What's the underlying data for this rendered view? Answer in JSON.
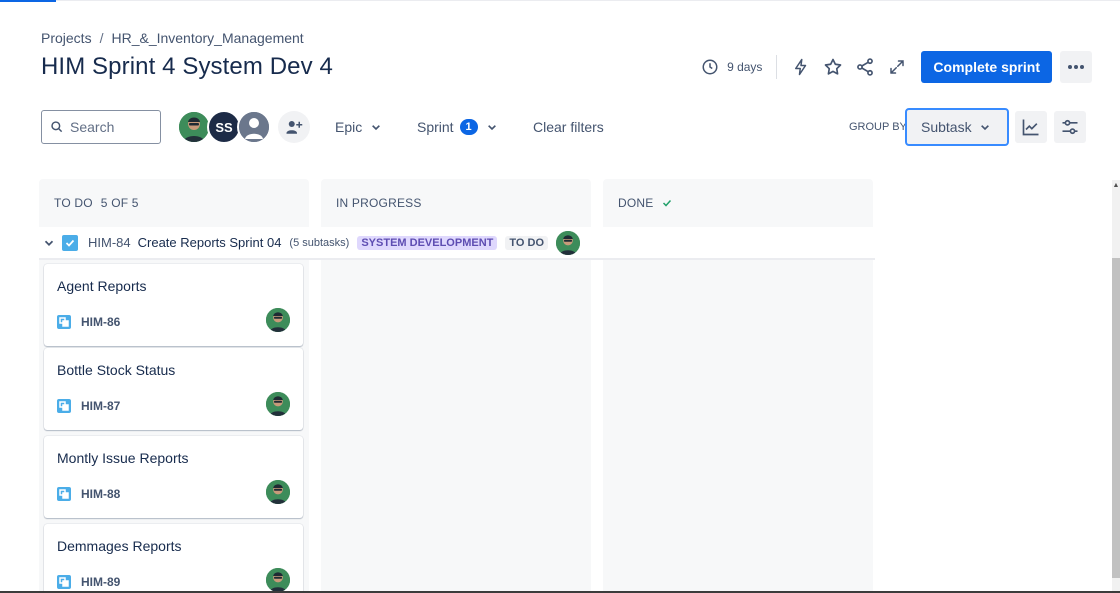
{
  "breadcrumb": {
    "projects": "Projects",
    "separator": "/",
    "project": "HR_&_Inventory_Management"
  },
  "title": "HIM Sprint 4 System Dev 4",
  "header": {
    "days_remaining": "9 days",
    "complete_sprint": "Complete sprint",
    "icons": [
      "clock-icon",
      "lightning-icon",
      "star-icon",
      "share-icon",
      "expand-icon",
      "more-icon"
    ]
  },
  "toolbar": {
    "search_placeholder": "Search",
    "avatars": [
      {
        "type": "photo"
      },
      {
        "type": "initials",
        "initials": "SS"
      },
      {
        "type": "generic"
      }
    ],
    "filters": {
      "epic": "Epic",
      "sprint": "Sprint",
      "sprint_count": "1",
      "clear": "Clear filters"
    },
    "group_by_label": "GROUP BY",
    "group_by_value": "Subtask"
  },
  "columns": [
    {
      "name": "TO DO",
      "count_text": "5 OF 5"
    },
    {
      "name": "IN PROGRESS"
    },
    {
      "name": "DONE"
    }
  ],
  "swimlane": {
    "key": "HIM-84",
    "summary": "Create Reports Sprint 04",
    "subtask_count": "(5 subtasks)",
    "epic": "SYSTEM DEVELOPMENT",
    "status": "TO DO"
  },
  "cards": [
    {
      "title": "Agent Reports",
      "key": "HIM-86"
    },
    {
      "title": "Bottle Stock Status",
      "key": "HIM-87"
    },
    {
      "title": "Montly Issue Reports",
      "key": "HIM-88"
    },
    {
      "title": "Demmages Reports",
      "key": "HIM-89"
    }
  ],
  "colors": {
    "primary": "#0c66e4",
    "subtask": "#4bade8",
    "epic_lozenge_bg": "#dfd8fd",
    "epic_lozenge_text": "#5e4db2",
    "done_check": "#22a06b"
  }
}
